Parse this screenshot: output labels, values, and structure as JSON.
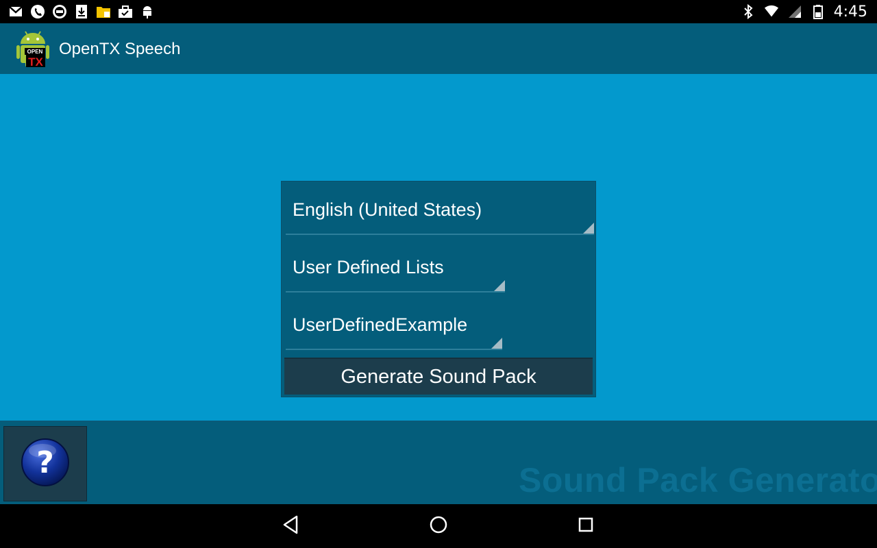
{
  "status_bar": {
    "time": "4:45",
    "left_icons": [
      "gmail-icon",
      "phone-icon",
      "media-icon",
      "download-icon",
      "file-icon",
      "briefcase-icon",
      "android-debug-icon"
    ],
    "right_icons": [
      "bluetooth-icon",
      "wifi-icon",
      "signal-icon",
      "battery-icon"
    ]
  },
  "action_bar": {
    "title": "OpenTX Speech",
    "logo_text_top": "OPEN",
    "logo_text_bottom": "TX"
  },
  "form": {
    "language_value": "English (United States)",
    "list_type_value": "User Defined Lists",
    "list_name_value": "UserDefinedExample",
    "generate_button_label": "Generate Sound Pack"
  },
  "bottom": {
    "help_icon": "help-question-icon",
    "watermark_text": "Sound Pack Generator"
  },
  "nav": {
    "back_icon": "back-icon",
    "home_icon": "home-icon",
    "recents_icon": "recents-icon"
  },
  "colors": {
    "content_background": "#0399cd",
    "bar_background": "#045d7b",
    "button_background": "#1c3d4c",
    "watermark_color": "#0c6f92"
  }
}
